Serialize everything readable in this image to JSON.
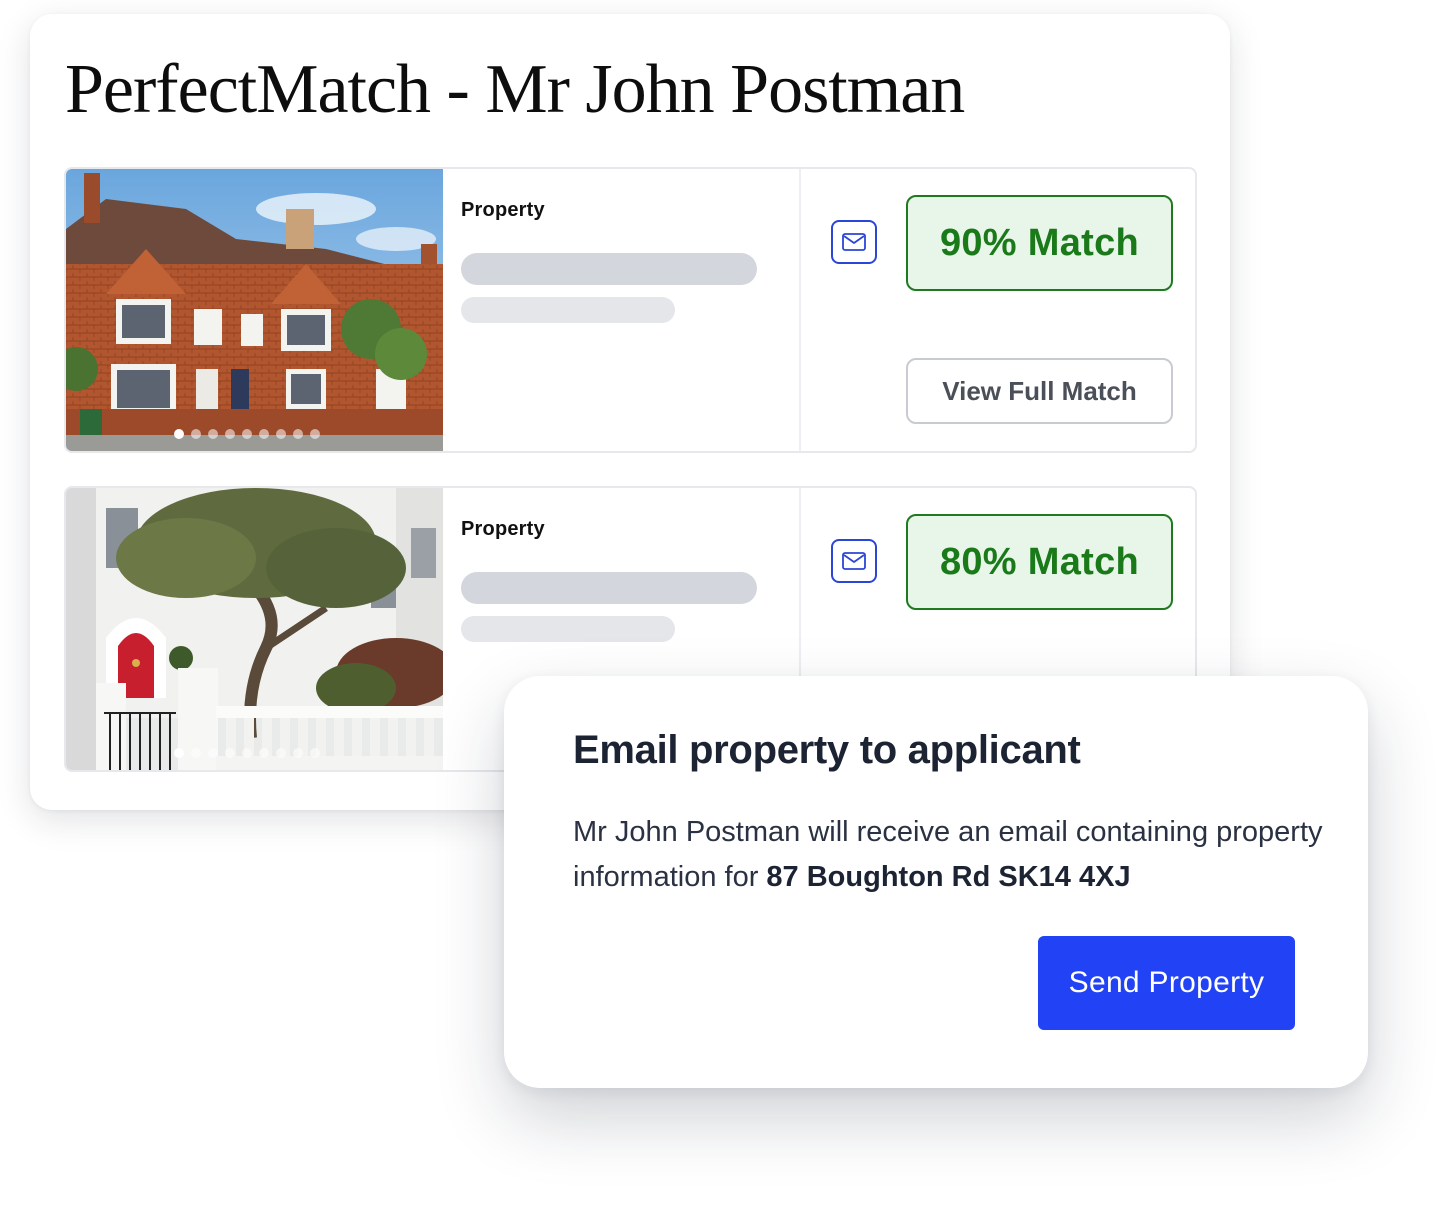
{
  "page": {
    "title": "PerfectMatch - Mr John Postman"
  },
  "properties": [
    {
      "label": "Property",
      "match": "90% Match",
      "view_label": "View Full Match",
      "photo": "red-brick-terraced-houses",
      "carousel_count": 9,
      "carousel_active": 1
    },
    {
      "label": "Property",
      "match": "80% Match",
      "photo": "white-townhouse-red-door",
      "carousel_count": 9,
      "carousel_active": 1
    }
  ],
  "modal": {
    "title": "Email property to applicant",
    "body_prefix": "Mr John Postman will receive an email containing property information for ",
    "address": "87 Boughton Rd SK14 4XJ",
    "send_label": "Send Property"
  },
  "icons": {
    "email": "envelope-icon"
  },
  "colors": {
    "accent_blue": "#2142f5",
    "match_green": "#1a7a1a",
    "match_bg": "#e8f5e9"
  }
}
